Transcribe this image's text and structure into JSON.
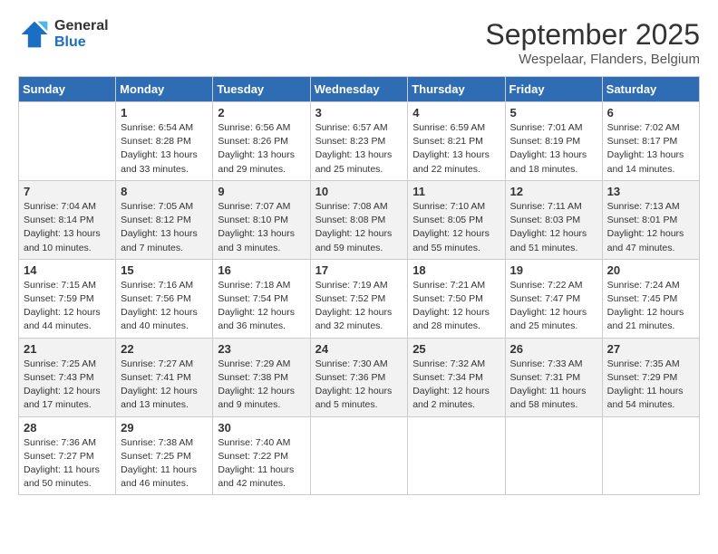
{
  "header": {
    "logo_line1": "General",
    "logo_line2": "Blue",
    "title": "September 2025",
    "subtitle": "Wespelaar, Flanders, Belgium"
  },
  "columns": [
    "Sunday",
    "Monday",
    "Tuesday",
    "Wednesday",
    "Thursday",
    "Friday",
    "Saturday"
  ],
  "weeks": [
    [
      {
        "day": "",
        "info": ""
      },
      {
        "day": "1",
        "info": "Sunrise: 6:54 AM\nSunset: 8:28 PM\nDaylight: 13 hours\nand 33 minutes."
      },
      {
        "day": "2",
        "info": "Sunrise: 6:56 AM\nSunset: 8:26 PM\nDaylight: 13 hours\nand 29 minutes."
      },
      {
        "day": "3",
        "info": "Sunrise: 6:57 AM\nSunset: 8:23 PM\nDaylight: 13 hours\nand 25 minutes."
      },
      {
        "day": "4",
        "info": "Sunrise: 6:59 AM\nSunset: 8:21 PM\nDaylight: 13 hours\nand 22 minutes."
      },
      {
        "day": "5",
        "info": "Sunrise: 7:01 AM\nSunset: 8:19 PM\nDaylight: 13 hours\nand 18 minutes."
      },
      {
        "day": "6",
        "info": "Sunrise: 7:02 AM\nSunset: 8:17 PM\nDaylight: 13 hours\nand 14 minutes."
      }
    ],
    [
      {
        "day": "7",
        "info": "Sunrise: 7:04 AM\nSunset: 8:14 PM\nDaylight: 13 hours\nand 10 minutes."
      },
      {
        "day": "8",
        "info": "Sunrise: 7:05 AM\nSunset: 8:12 PM\nDaylight: 13 hours\nand 7 minutes."
      },
      {
        "day": "9",
        "info": "Sunrise: 7:07 AM\nSunset: 8:10 PM\nDaylight: 13 hours\nand 3 minutes."
      },
      {
        "day": "10",
        "info": "Sunrise: 7:08 AM\nSunset: 8:08 PM\nDaylight: 12 hours\nand 59 minutes."
      },
      {
        "day": "11",
        "info": "Sunrise: 7:10 AM\nSunset: 8:05 PM\nDaylight: 12 hours\nand 55 minutes."
      },
      {
        "day": "12",
        "info": "Sunrise: 7:11 AM\nSunset: 8:03 PM\nDaylight: 12 hours\nand 51 minutes."
      },
      {
        "day": "13",
        "info": "Sunrise: 7:13 AM\nSunset: 8:01 PM\nDaylight: 12 hours\nand 47 minutes."
      }
    ],
    [
      {
        "day": "14",
        "info": "Sunrise: 7:15 AM\nSunset: 7:59 PM\nDaylight: 12 hours\nand 44 minutes."
      },
      {
        "day": "15",
        "info": "Sunrise: 7:16 AM\nSunset: 7:56 PM\nDaylight: 12 hours\nand 40 minutes."
      },
      {
        "day": "16",
        "info": "Sunrise: 7:18 AM\nSunset: 7:54 PM\nDaylight: 12 hours\nand 36 minutes."
      },
      {
        "day": "17",
        "info": "Sunrise: 7:19 AM\nSunset: 7:52 PM\nDaylight: 12 hours\nand 32 minutes."
      },
      {
        "day": "18",
        "info": "Sunrise: 7:21 AM\nSunset: 7:50 PM\nDaylight: 12 hours\nand 28 minutes."
      },
      {
        "day": "19",
        "info": "Sunrise: 7:22 AM\nSunset: 7:47 PM\nDaylight: 12 hours\nand 25 minutes."
      },
      {
        "day": "20",
        "info": "Sunrise: 7:24 AM\nSunset: 7:45 PM\nDaylight: 12 hours\nand 21 minutes."
      }
    ],
    [
      {
        "day": "21",
        "info": "Sunrise: 7:25 AM\nSunset: 7:43 PM\nDaylight: 12 hours\nand 17 minutes."
      },
      {
        "day": "22",
        "info": "Sunrise: 7:27 AM\nSunset: 7:41 PM\nDaylight: 12 hours\nand 13 minutes."
      },
      {
        "day": "23",
        "info": "Sunrise: 7:29 AM\nSunset: 7:38 PM\nDaylight: 12 hours\nand 9 minutes."
      },
      {
        "day": "24",
        "info": "Sunrise: 7:30 AM\nSunset: 7:36 PM\nDaylight: 12 hours\nand 5 minutes."
      },
      {
        "day": "25",
        "info": "Sunrise: 7:32 AM\nSunset: 7:34 PM\nDaylight: 12 hours\nand 2 minutes."
      },
      {
        "day": "26",
        "info": "Sunrise: 7:33 AM\nSunset: 7:31 PM\nDaylight: 11 hours\nand 58 minutes."
      },
      {
        "day": "27",
        "info": "Sunrise: 7:35 AM\nSunset: 7:29 PM\nDaylight: 11 hours\nand 54 minutes."
      }
    ],
    [
      {
        "day": "28",
        "info": "Sunrise: 7:36 AM\nSunset: 7:27 PM\nDaylight: 11 hours\nand 50 minutes."
      },
      {
        "day": "29",
        "info": "Sunrise: 7:38 AM\nSunset: 7:25 PM\nDaylight: 11 hours\nand 46 minutes."
      },
      {
        "day": "30",
        "info": "Sunrise: 7:40 AM\nSunset: 7:22 PM\nDaylight: 11 hours\nand 42 minutes."
      },
      {
        "day": "",
        "info": ""
      },
      {
        "day": "",
        "info": ""
      },
      {
        "day": "",
        "info": ""
      },
      {
        "day": "",
        "info": ""
      }
    ]
  ]
}
